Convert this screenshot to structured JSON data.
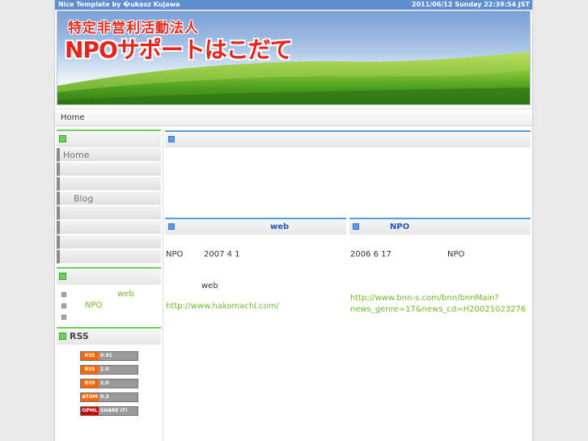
{
  "topbar": {
    "credit": "Nice Template by �ukasz Kujawa",
    "datetime": "2011/06/12 Sunday 22:39:54 JST"
  },
  "banner": {
    "subtitle": "特定非営利活動法人",
    "title": "NPOサポートはこだて"
  },
  "nav": {
    "home": "Home"
  },
  "sidebar": {
    "menu_heading": "",
    "menu_items": [
      "Home",
      "",
      "",
      "Blog",
      "",
      "",
      "",
      ""
    ],
    "news_heading": "",
    "news_items": [
      "web",
      "NPO",
      ""
    ],
    "rss_heading": "RSS",
    "feeds": [
      {
        "kind": "RSS",
        "version": "0.91"
      },
      {
        "kind": "RSS",
        "version": "1.0"
      },
      {
        "kind": "RSS",
        "version": "2.0"
      },
      {
        "kind": "ATOM",
        "version": "0.3"
      },
      {
        "kind": "OPML",
        "version": "SHARE IT!"
      }
    ]
  },
  "main": {
    "top_box_title": "",
    "left_box": {
      "title": "web",
      "line1_a": "NPO",
      "line1_b": "2007 4 1",
      "line2": "web",
      "link": "http://www.hakomachi.com/"
    },
    "right_box": {
      "title": "NPO",
      "line1_a": "2006 6 17",
      "line1_b": "NPO",
      "link_line1": "http://www.bnn-s.com/bnn/bnnMain?",
      "link_line2": "news_genre=17&news_cd=H20021023276"
    }
  },
  "colors": {
    "accent_green": "#6bd457",
    "accent_blue": "#5b9ce6",
    "link_green": "#6cbc2c",
    "title_red": "#e9231a"
  }
}
